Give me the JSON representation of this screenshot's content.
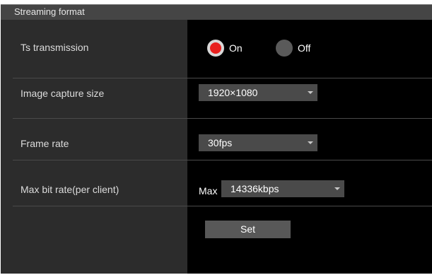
{
  "section": {
    "title": "Streaming format"
  },
  "rows": {
    "ts_transmission": {
      "label": "Ts transmission",
      "on_label": "On",
      "off_label": "Off",
      "selected": "On"
    },
    "image_capture_size": {
      "label": "Image capture size",
      "value": "1920×1080"
    },
    "frame_rate": {
      "label": "Frame rate",
      "value": "30fps"
    },
    "max_bit_rate": {
      "label": "Max bit rate(per client)",
      "prefix": "Max",
      "value": "14336kbps"
    }
  },
  "actions": {
    "set_label": "Set"
  },
  "colors": {
    "radio_selected": "#e8201e",
    "label_column_bg": "#2c2c2c",
    "value_column_bg": "#000000",
    "header_bg": "#454545"
  },
  "icons": {
    "dropdown": "chevron-down-icon"
  }
}
